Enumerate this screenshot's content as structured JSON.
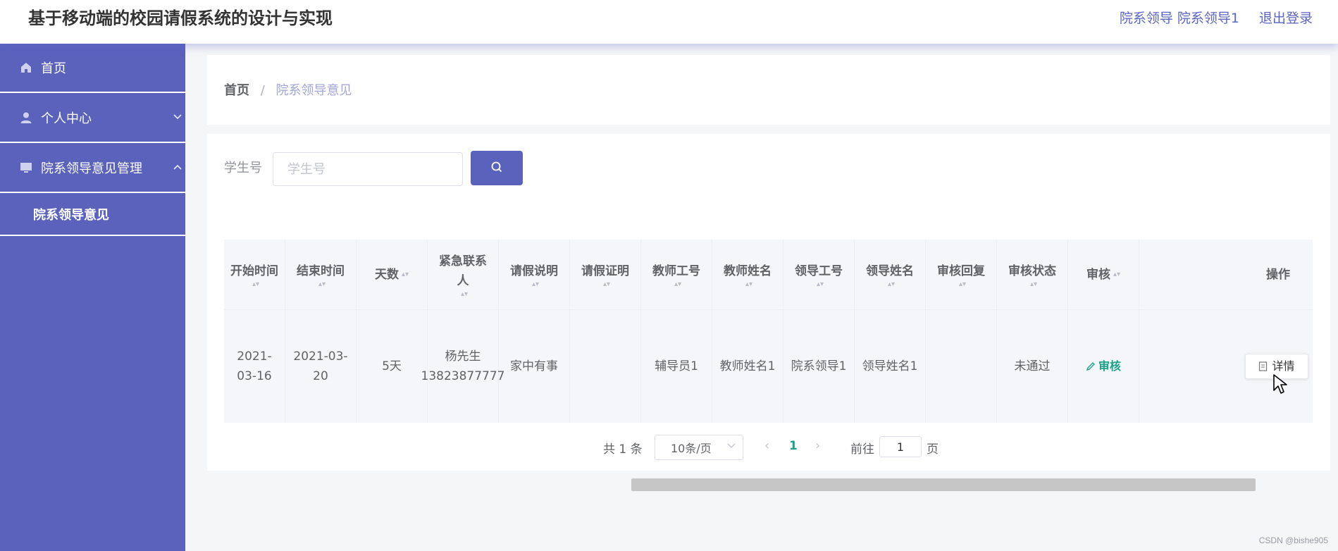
{
  "header": {
    "title": "基于移动端的校园请假系统的设计与实现",
    "user": "院系领导 院系领导1",
    "logout": "退出登录"
  },
  "sidebar": {
    "items": [
      {
        "label": "首页",
        "icon": "home-icon"
      },
      {
        "label": "个人中心",
        "icon": "user-icon",
        "chevron": "˅"
      },
      {
        "label": "院系领导意见管理",
        "icon": "monitor-icon",
        "chevron": "˄"
      }
    ],
    "sub_item": "院系领导意见"
  },
  "breadcrumb": {
    "home": "首页",
    "separator": "/",
    "current": "院系领导意见"
  },
  "search": {
    "label": "学生号",
    "placeholder": "学生号",
    "button_icon": "search-icon"
  },
  "table": {
    "headers": [
      "开始时间",
      "结束时间",
      "天数",
      "紧急联系人",
      "请假说明",
      "请假证明",
      "教师工号",
      "教师姓名",
      "领导工号",
      "领导姓名",
      "审核回复",
      "审核状态",
      "审核",
      "操作"
    ],
    "rows": [
      {
        "start": "2021-03-16",
        "end": "2021-03-20",
        "days": "5天",
        "contact": "杨先生 13823877777",
        "reason": "家中有事",
        "proof": "",
        "teacher_id": "辅导员1",
        "teacher_name": "教师姓名1",
        "leader_id": "院系领导1",
        "leader_name": "领导姓名1",
        "reply": "",
        "status": "未通过",
        "audit": "审核",
        "action": "详情"
      }
    ]
  },
  "pagination": {
    "total": "共 1 条",
    "page_size": "10条/页",
    "current_page": "1",
    "goto_label": "前往",
    "goto_value": "1",
    "page_unit": "页"
  },
  "watermark": "CSDN @bishe905",
  "colors": {
    "primary": "#5a62bb",
    "link": "#1aa388"
  }
}
